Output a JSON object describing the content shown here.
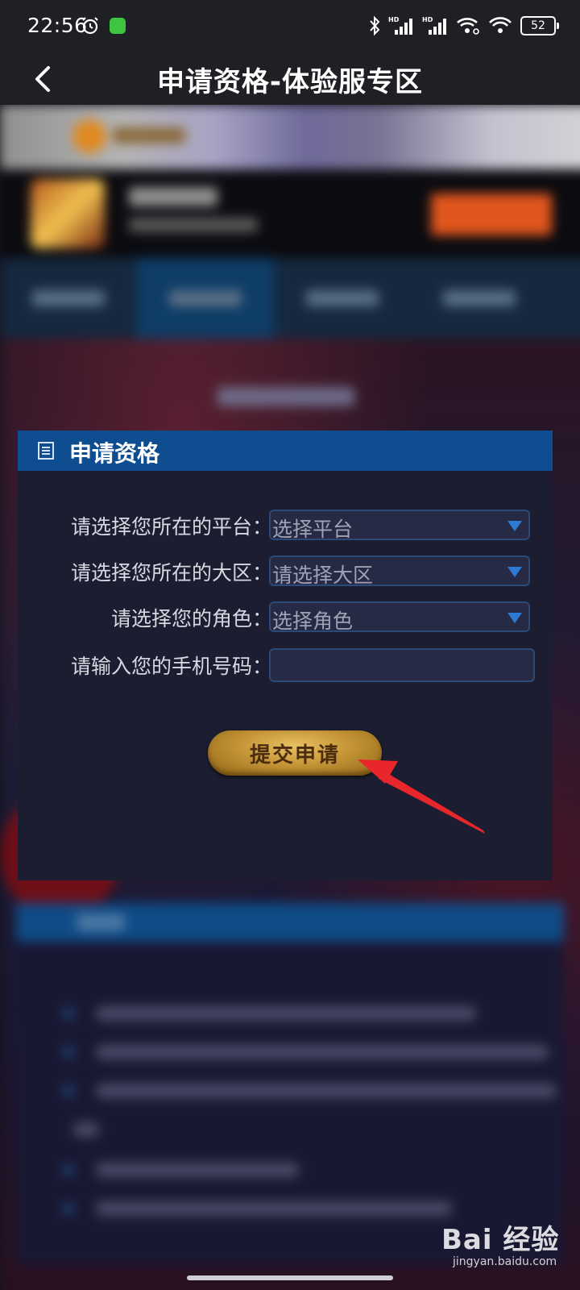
{
  "status_bar": {
    "time": "22:56",
    "battery": "52",
    "alarm_icon": "alarm-icon",
    "app_icon": "notification-app-icon",
    "icons": [
      "bluetooth-icon",
      "signal-hd-icon",
      "signal-hd-icon",
      "wifi-link-icon",
      "wifi-icon",
      "battery-icon"
    ]
  },
  "app_bar": {
    "back_icon": "back-arrow-icon",
    "title": "申请资格-体验服专区"
  },
  "apply_panel": {
    "icon": "list-document-icon",
    "title": "申请资格",
    "platform_label": "请选择您所在的平台：",
    "platform_value": "选择平台",
    "region_label": "请选择您所在的大区：",
    "region_value": "请选择大区",
    "role_label": "请选择您的角色：",
    "role_value": "选择角色",
    "phone_label": "请输入您的手机号码：",
    "phone_value": "",
    "submit_label": "提交申请"
  },
  "annotation": {
    "arrow_icon": "red-arrow-icon",
    "color": "#e8262b"
  },
  "watermark": {
    "brand": "Bai 经验",
    "url": "jingyan.baidu.com"
  },
  "colors": {
    "header_blue": "#0e4d8f",
    "caret_blue": "#2c7ad6",
    "button_gold": "#c49536"
  }
}
